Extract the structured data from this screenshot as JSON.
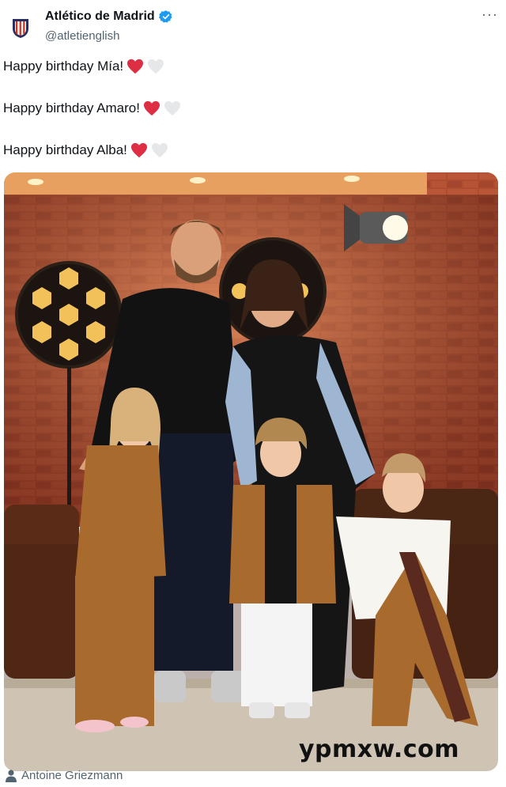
{
  "account": {
    "name": "Atlético de Madrid",
    "handle": "@atletienglish",
    "verified": true
  },
  "menu": {
    "more_glyph": "···"
  },
  "tweet": {
    "lines": [
      "Happy birthday Mía!",
      "Happy birthday Amaro!",
      "Happy birthday Alba!"
    ]
  },
  "media": {
    "tagged_person": "Antoine Griezmann",
    "watermark": "ypmxw.com"
  },
  "colors": {
    "heart_red": "#dd2e44",
    "heart_white": "#e6e7e8",
    "verified_blue": "#1d9bf0",
    "secondary_text": "#536471"
  }
}
